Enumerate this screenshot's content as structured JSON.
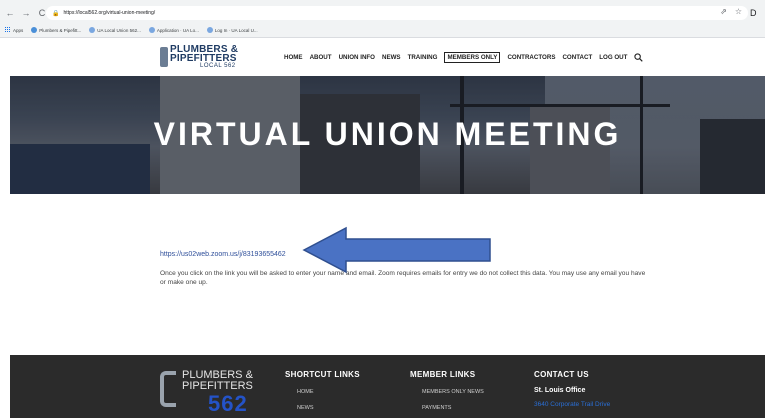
{
  "browser": {
    "url": "https://local562.org/virtual-union-meeting/",
    "nav_back": "←",
    "nav_forward": "→",
    "nav_reload": "C",
    "share": "⇗",
    "star": "☆",
    "ext": "D",
    "bookmarks": [
      {
        "label": "Apps"
      },
      {
        "label": "Plumbers & Pipefitt..."
      },
      {
        "label": "UA Local Union 562..."
      },
      {
        "label": "Application · UA Lo..."
      },
      {
        "label": "Log In · UA Local U..."
      }
    ]
  },
  "logo": {
    "line1": "PLUMBERS &",
    "line2": "PIPEFITTERS",
    "line3": "LOCAL 562"
  },
  "nav": [
    {
      "label": "HOME"
    },
    {
      "label": "ABOUT"
    },
    {
      "label": "UNION INFO"
    },
    {
      "label": "NEWS"
    },
    {
      "label": "TRAINING"
    },
    {
      "label": "MEMBERS ONLY"
    },
    {
      "label": "CONTRACTORS"
    },
    {
      "label": "CONTACT"
    },
    {
      "label": "LOG OUT"
    }
  ],
  "hero": {
    "title": "VIRTUAL UNION MEETING"
  },
  "content": {
    "link": "https://us02web.zoom.us/j/83193655462",
    "note": "Once you click on the link you will be asked to enter your name and email. Zoom requires emails for entry we do not collect this data. You may use any email you have or make one up."
  },
  "footer": {
    "logo_line1": "PLUMBERS &",
    "logo_line2": "PIPEFITTERS",
    "logo_num": "562",
    "shortcut_title": "SHORTCUT LINKS",
    "shortcut_items": [
      "HOME",
      "NEWS"
    ],
    "member_title": "MEMBER LINKS",
    "member_items": [
      "MEMBERS ONLY NEWS",
      "PAYMENTS"
    ],
    "contact_title": "CONTACT US",
    "office": "St. Louis Office",
    "address": "3640 Corporate Trail Drive"
  },
  "colors": {
    "arrow_fill": "#4a72c4",
    "arrow_stroke": "#2f4f8f",
    "brand_navy": "#1f3b63",
    "footer_bg": "#2b2b2b"
  }
}
